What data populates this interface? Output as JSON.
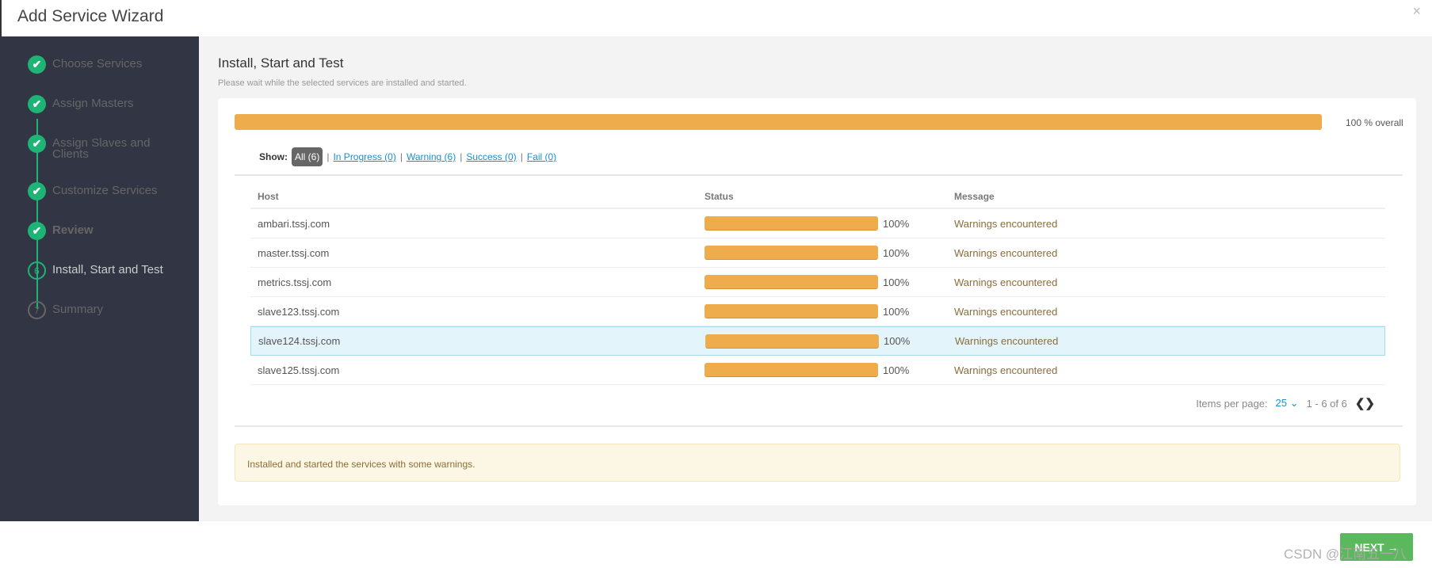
{
  "header": {
    "title": "Add Service Wizard",
    "close": "×"
  },
  "sidebar": {
    "steps": [
      {
        "label": "Choose Services",
        "state": "done",
        "marker": "✔"
      },
      {
        "label": "Assign Masters",
        "state": "done",
        "marker": "✔"
      },
      {
        "label": "Assign Slaves and Clients",
        "state": "done",
        "marker": "✔"
      },
      {
        "label": "Customize Services",
        "state": "done",
        "marker": "✔"
      },
      {
        "label": "Review",
        "state": "done",
        "marker": "✔"
      },
      {
        "label": "Install, Start and Test",
        "state": "current",
        "marker": "6"
      },
      {
        "label": "Summary",
        "state": "todo",
        "marker": "7"
      }
    ]
  },
  "main": {
    "title": "Install, Start and Test",
    "subtitle": "Please wait while the selected services are installed and started.",
    "overall_progress": 100,
    "overall_label": "100 % overall",
    "filters": {
      "show": "Show:",
      "all": "All (6)",
      "in_progress": "In Progress (0)",
      "warning": "Warning (6)",
      "success": "Success (0)",
      "fail": "Fail (0)",
      "sep": "|"
    },
    "table": {
      "headers": [
        "Host",
        "Status",
        "Message"
      ],
      "rows": [
        {
          "host": "ambari.tssj.com",
          "progress": 100,
          "pct": "100%",
          "message": "Warnings encountered"
        },
        {
          "host": "master.tssj.com",
          "progress": 100,
          "pct": "100%",
          "message": "Warnings encountered"
        },
        {
          "host": "metrics.tssj.com",
          "progress": 100,
          "pct": "100%",
          "message": "Warnings encountered"
        },
        {
          "host": "slave123.tssj.com",
          "progress": 100,
          "pct": "100%",
          "message": "Warnings encountered"
        },
        {
          "host": "slave124.tssj.com",
          "progress": 100,
          "pct": "100%",
          "message": "Warnings encountered"
        },
        {
          "host": "slave125.tssj.com",
          "progress": 100,
          "pct": "100%",
          "message": "Warnings encountered"
        }
      ]
    },
    "pager": {
      "label": "Items per page:",
      "value": "25",
      "range": "1 - 6 of 6",
      "prev": "❮",
      "next": "❯"
    },
    "alert": "Installed and started the services with some warnings."
  },
  "footer": {
    "next": "NEXT →",
    "watermark": "CSDN @江南五一八"
  },
  "colors": {
    "accent": "#1eb475",
    "progress": "#eeac4c",
    "next": "#5cb85c",
    "sidebar": "#323544"
  }
}
